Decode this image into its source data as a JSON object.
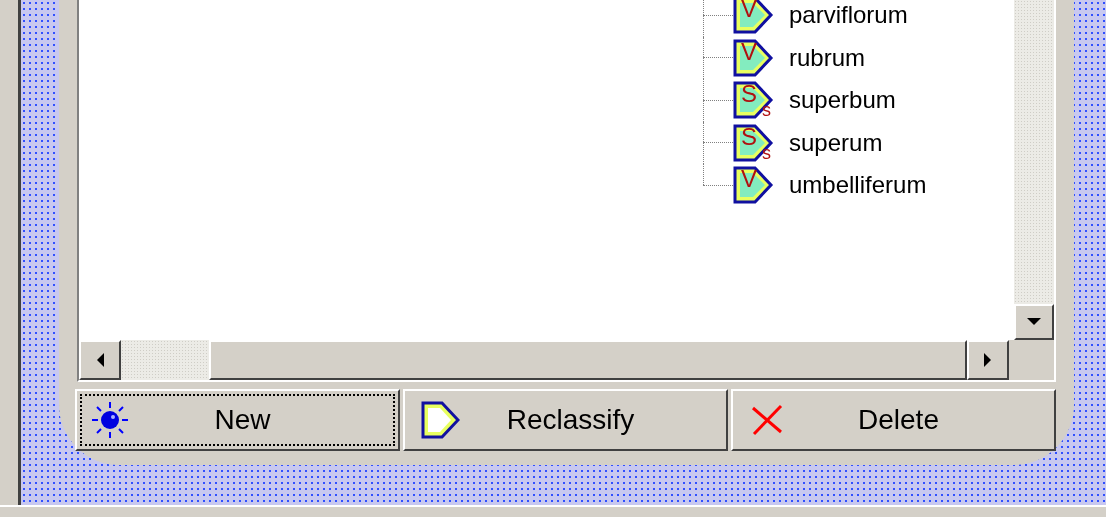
{
  "tree": {
    "items": [
      {
        "label": "parviflorum",
        "icon_letter": "V"
      },
      {
        "label": "rubrum",
        "icon_letter": "V"
      },
      {
        "label": "superbum",
        "icon_letter": "S",
        "icon_sub": "s"
      },
      {
        "label": "superum",
        "icon_letter": "S",
        "icon_sub": "s"
      },
      {
        "label": "umbelliferum",
        "icon_letter": "V"
      }
    ]
  },
  "buttons": [
    {
      "label": "New",
      "kind": "new",
      "focused": true
    },
    {
      "label": "Reclassify",
      "kind": "reclassify",
      "focused": false
    },
    {
      "label": "Delete",
      "kind": "delete",
      "focused": false
    }
  ]
}
